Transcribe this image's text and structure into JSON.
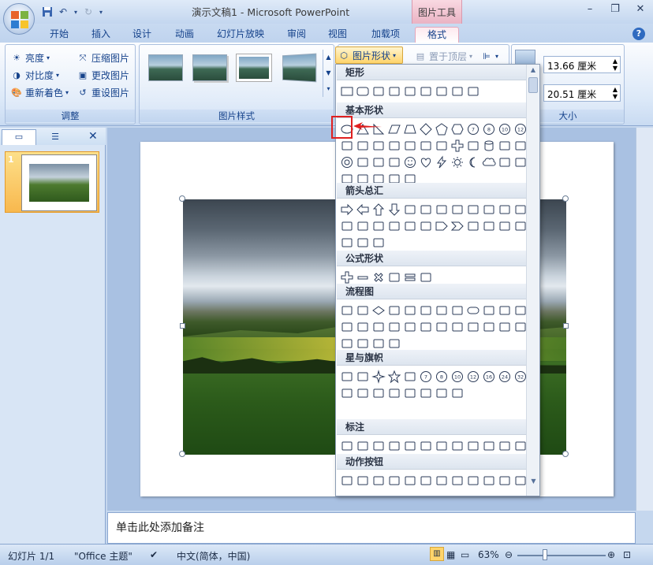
{
  "window": {
    "title": "演示文稿1 - Microsoft PowerPoint",
    "contextual_tab": "图片工具"
  },
  "tabs": [
    "开始",
    "插入",
    "设计",
    "动画",
    "幻灯片放映",
    "审阅",
    "视图",
    "加载项",
    "格式"
  ],
  "active_tab": "格式",
  "ribbon": {
    "adjust": {
      "label": "调整",
      "brightness": "亮度",
      "contrast": "对比度",
      "recolor": "重新着色",
      "compress": "压缩图片",
      "change": "更改图片",
      "reset": "重设图片"
    },
    "styles": {
      "label": "图片样式"
    },
    "shape_button": "图片形状",
    "bring_front": "置于顶层",
    "size": {
      "label": "大小",
      "height": "13.66 厘米",
      "width": "20.51 厘米"
    }
  },
  "shapes_menu": {
    "sections": [
      {
        "title": "矩形",
        "shapes": [
          "rect",
          "round-rect",
          "snip1",
          "snip2a",
          "snip2b",
          "snipround",
          "round1",
          "round2a",
          "round2b"
        ]
      },
      {
        "title": "基本形状",
        "shapes": [
          "ellipse",
          "triangle",
          "rtriangle",
          "parallelogram",
          "trapezoid",
          "diamond",
          "pentagon",
          "hexagon",
          "heptagon-7",
          "octagon-8",
          "decagon-10",
          "dodecagon-12",
          "pie",
          "chord",
          "teardrop",
          "frame",
          "halfframe",
          "corner",
          "diagstripe",
          "plus",
          "plaque",
          "can",
          "cube",
          "bevel",
          "donut",
          "nosmoking",
          "blockarc",
          "foldedcorner",
          "smiley",
          "heart",
          "lightning",
          "sun",
          "moon",
          "cloud",
          "arc",
          "bracketpair",
          "bracepair",
          "leftbracket",
          "rightbracket",
          "leftbrace",
          "rightbrace"
        ]
      },
      {
        "title": "箭头总汇",
        "shapes": [
          "rightarrow",
          "leftarrow",
          "uparrow",
          "downarrow",
          "lrarrow",
          "udarrow",
          "quadarrow",
          "lruarrow",
          "bentarrow",
          "uturn",
          "leftuparrow",
          "bentuparrow",
          "curvedright",
          "curvedleft",
          "curvedup",
          "curveddown",
          "stripedright",
          "notchedright",
          "homeplate",
          "chevron",
          "rightcallout",
          "downcallout",
          "leftcallout",
          "upcallout",
          "lrcallout",
          "quadcallout",
          "circulararrow"
        ]
      },
      {
        "title": "公式形状",
        "shapes": [
          "plus",
          "minus",
          "multiply",
          "divide",
          "equal",
          "notequal"
        ]
      },
      {
        "title": "流程图",
        "shapes": [
          "process",
          "altprocess",
          "decision",
          "data",
          "predefined",
          "internalstorage",
          "document",
          "multidoc",
          "terminator",
          "preparation",
          "manualinput",
          "manualop",
          "connector",
          "offpage",
          "card",
          "punchedtape",
          "summing",
          "or",
          "collate",
          "sort",
          "extract",
          "merge",
          "storeddata",
          "delay",
          "seqaccess",
          "magdisk",
          "directaccess",
          "display"
        ]
      },
      {
        "title": "星与旗帜",
        "shapes": [
          "explosion1",
          "explosion2",
          "star4",
          "star5",
          "star6",
          "star7",
          "star8",
          "star10",
          "star12",
          "star16",
          "star24",
          "star32",
          "ribbon2",
          "ribbon",
          "ellipseribbon2",
          "ellipseribbon",
          "vscroll",
          "hscroll",
          "wave",
          "doublewave"
        ]
      },
      {
        "title": "标注",
        "shapes": [
          "rectcallout",
          "roundcallout",
          "ovalcallout",
          "cloudcallout",
          "line1",
          "line2",
          "line3",
          "accent1",
          "accent2",
          "accent3",
          "border1",
          "border2",
          "border3",
          "accentborder1",
          "accentborder2",
          "accentborder3"
        ]
      },
      {
        "title": "动作按钮",
        "shapes": [
          "back",
          "forward",
          "beginning",
          "end",
          "home",
          "info",
          "return",
          "movie",
          "doc",
          "sound",
          "help",
          "blank"
        ]
      }
    ]
  },
  "slides_pane": {
    "slide_number": "1"
  },
  "notes_placeholder": "单击此处添加备注",
  "statusbar": {
    "slide": "幻灯片 1/1",
    "theme": "\"Office 主题\"",
    "language": "中文(简体，中国)",
    "zoom": "63%"
  },
  "colors": {
    "accent": "#ffd46b",
    "highlight": "#e02020",
    "tab_pink": "#eab3c4"
  }
}
